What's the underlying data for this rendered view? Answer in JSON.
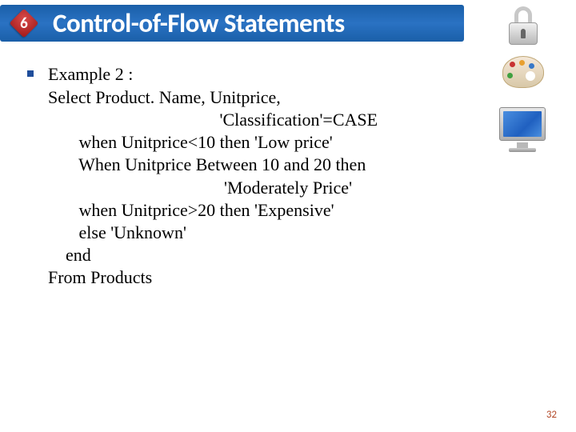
{
  "header": {
    "chapter_number": "6",
    "title": "Control-of-Flow Statements"
  },
  "content": {
    "example_label": "Example 2 :",
    "code": "Select Product. Name, Unitprice,\n                                       'Classification'=CASE\n       when Unitprice<10 then 'Low price'\n       When Unitprice Between 10 and 20 then\n                                        'Moderately Price'\n       when Unitprice>20 then 'Expensive'\n       else 'Unknown'\n    end\nFrom Products"
  },
  "page_number": "32"
}
